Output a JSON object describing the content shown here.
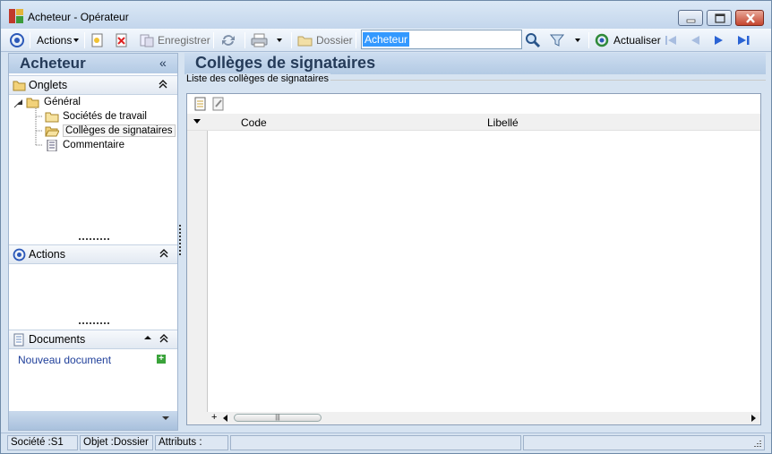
{
  "window": {
    "title": "Acheteur -  Opérateur"
  },
  "toolbar": {
    "actions_label": "Actions",
    "save_label": "Enregistrer",
    "dossier_label": "Dossier",
    "search_value": "Acheteur",
    "refresh_label": "Actualiser"
  },
  "left_panel": {
    "title": "Acheteur",
    "collapse_glyph": "«",
    "onglets": {
      "title": "Onglets",
      "tree": {
        "root": "Général",
        "children": [
          "Sociétés de travail",
          "Collèges de signataires",
          "Commentaire"
        ]
      }
    },
    "actions": {
      "title": "Actions"
    },
    "documents": {
      "title": "Documents",
      "new_doc_label": "Nouveau document"
    }
  },
  "main": {
    "title": "Collèges de signataires",
    "group_label": "Liste des collèges de signataires",
    "grid": {
      "columns": [
        "Code",
        "Libellé"
      ]
    }
  },
  "status_bar": {
    "societe": "Société :S1",
    "objet": "Objet :Dossier",
    "attributs": "Attributs :"
  },
  "colors": {
    "panel_header": "#b3cae4",
    "title_text": "#253b59",
    "link": "#1f3f9a",
    "selection": "#3399ff"
  }
}
